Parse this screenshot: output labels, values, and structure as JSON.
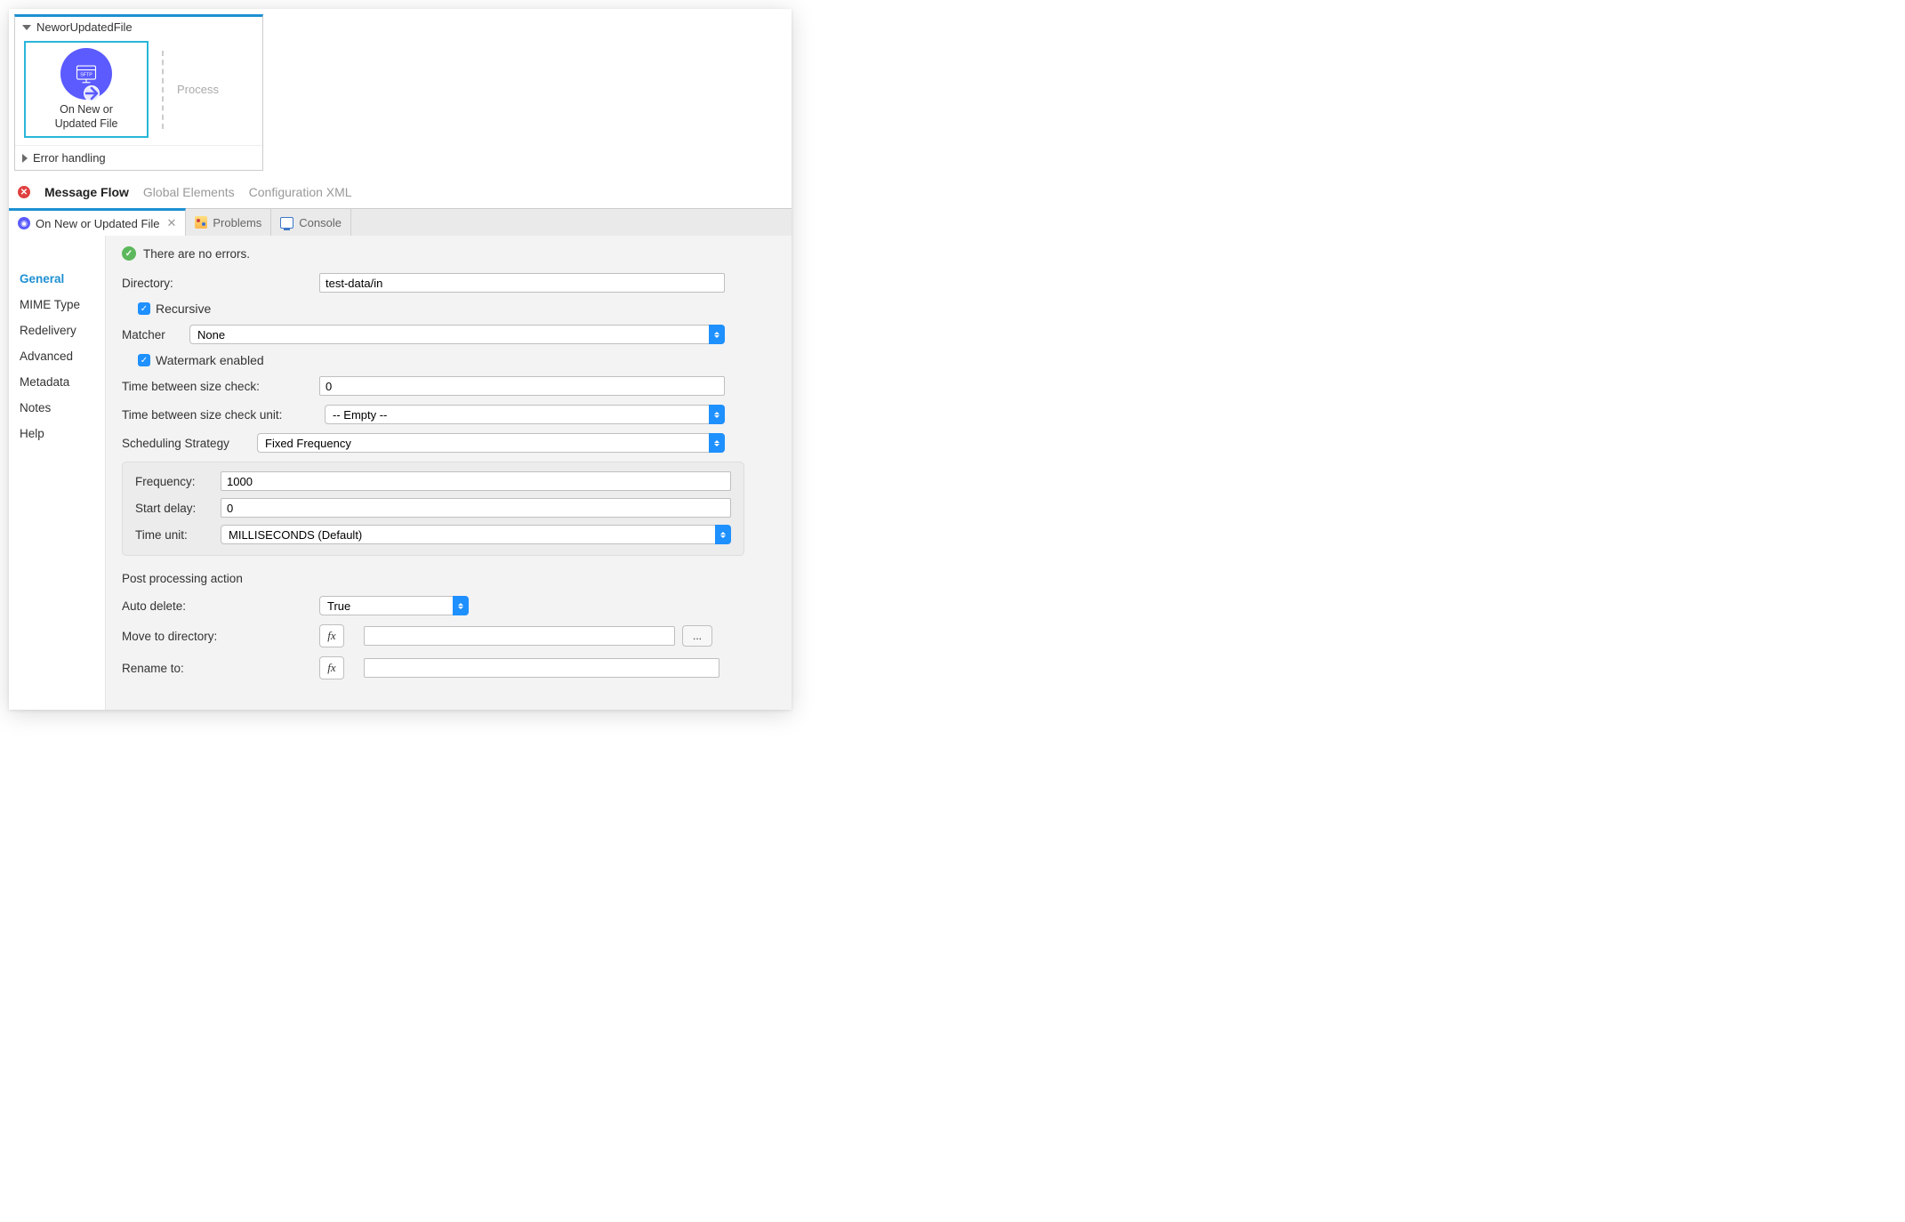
{
  "flow": {
    "name": "NeworUpdatedFile",
    "node_label_line1": "On New or",
    "node_label_line2": "Updated File",
    "node_badge": "SFTP",
    "process_label": "Process",
    "error_handling": "Error handling"
  },
  "editor_tabs": {
    "message_flow": "Message Flow",
    "global_elements": "Global Elements",
    "config_xml": "Configuration XML"
  },
  "panel_tabs": {
    "active": "On New or Updated File",
    "problems": "Problems",
    "console": "Console"
  },
  "status": "There are no errors.",
  "side_nav": [
    "General",
    "MIME Type",
    "Redelivery",
    "Advanced",
    "Metadata",
    "Notes",
    "Help"
  ],
  "form": {
    "directory_label": "Directory:",
    "directory_value": "test-data/in",
    "recursive_label": "Recursive",
    "matcher_label": "Matcher",
    "matcher_value": "None",
    "watermark_label": "Watermark enabled",
    "tbsc_label": "Time between size check:",
    "tbsc_value": "0",
    "tbscu_label": "Time between size check unit:",
    "tbscu_value": "-- Empty --",
    "sched_label": "Scheduling Strategy",
    "sched_value": "Fixed Frequency",
    "frequency_label": "Frequency:",
    "frequency_value": "1000",
    "startdelay_label": "Start delay:",
    "startdelay_value": "0",
    "timeunit_label": "Time unit:",
    "timeunit_value": "MILLISECONDS (Default)",
    "post_section": "Post processing action",
    "autodel_label": "Auto delete:",
    "autodel_value": "True",
    "movedir_label": "Move to directory:",
    "movedir_value": "",
    "rename_label": "Rename to:",
    "rename_value": "",
    "fx_label": "fx",
    "dots_label": "..."
  }
}
